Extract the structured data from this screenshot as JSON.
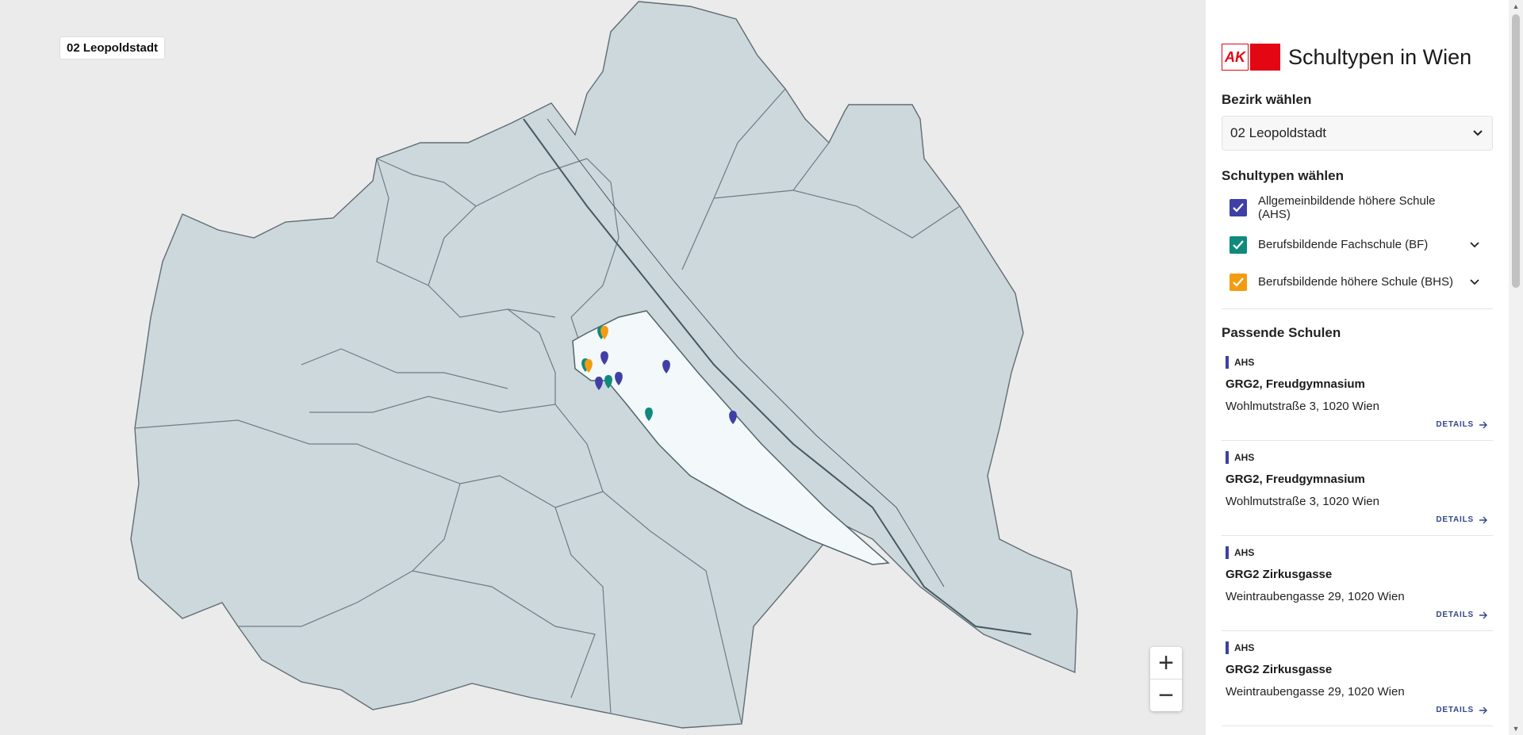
{
  "map": {
    "district_label": "02 Leopoldstadt",
    "zoom_in_label": "+",
    "zoom_out_label": "−",
    "marker_colors": {
      "ahs": "#3f3fa6",
      "bf": "#0f8a7d",
      "bhs": "#f39c12"
    }
  },
  "panel": {
    "title": "Schultypen in Wien",
    "logo_text": "AK",
    "district_heading": "Bezirk wählen",
    "district_selected": "02 Leopoldstadt",
    "types_heading": "Schultypen wählen",
    "types": [
      {
        "label": "Allgemeinbildende höhere Schule (AHS)",
        "color": "#3f3fa6",
        "checked": true,
        "expandable": false
      },
      {
        "label": "Berufsbildende Fachschule (BF)",
        "color": "#0f8a7d",
        "checked": true,
        "expandable": true
      },
      {
        "label": "Berufsbildende höhere Schule (BHS)",
        "color": "#f39c12",
        "checked": true,
        "expandable": true
      }
    ],
    "results_heading": "Passende Schulen",
    "schools": [
      {
        "type": "AHS",
        "name": "GRG2, Freudgymnasium",
        "address": "Wohlmutstraße 3, 1020 Wien",
        "details": "DETAILS"
      },
      {
        "type": "AHS",
        "name": "GRG2, Freudgymnasium",
        "address": "Wohlmutstraße 3, 1020 Wien",
        "details": "DETAILS"
      },
      {
        "type": "AHS",
        "name": "GRG2 Zirkusgasse",
        "address": "Weintraubengasse 29, 1020 Wien",
        "details": "DETAILS"
      },
      {
        "type": "AHS",
        "name": "GRG2 Zirkusgasse",
        "address": "Weintraubengasse 29, 1020 Wien",
        "details": "DETAILS"
      }
    ]
  }
}
